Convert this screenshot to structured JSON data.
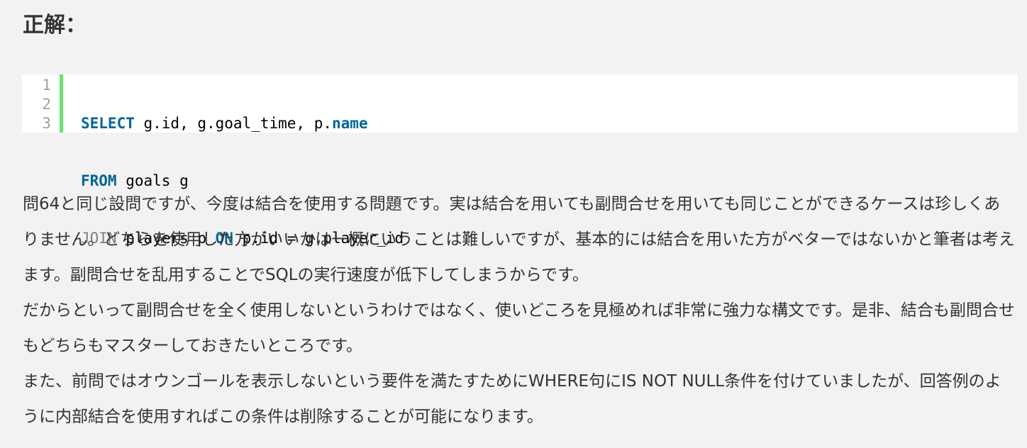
{
  "heading": "正解：",
  "code": {
    "line_numbers": [
      "1",
      "2",
      "3"
    ],
    "accent_color": "#6ce26c",
    "lines": [
      [
        {
          "text": "SELECT",
          "style": "keyword"
        },
        {
          "text": " g.id, g.goal_time, p.",
          "style": "plain"
        },
        {
          "text": "name",
          "style": "keyword"
        }
      ],
      [
        {
          "text": "FROM",
          "style": "keyword"
        },
        {
          "text": " goals g",
          "style": "plain"
        }
      ],
      [
        {
          "text": "JOIN",
          "style": "keyword-gray"
        },
        {
          "text": " players p ",
          "style": "plain"
        },
        {
          "text": "ON",
          "style": "keyword"
        },
        {
          "text": " p.id = g.player_id",
          "style": "plain"
        }
      ]
    ]
  },
  "explanation": {
    "paragraphs": [
      "問64と同じ設問ですが、今度は結合を使用する問題です。実は結合を用いても副問合せを用いても同じことができるケースは珍しくありません。どちらを使用した方がいいかは一概にいうことは難しいですが、基本的には結合を用いた方がベターではないかと筆者は考えます。副問合せを乱用することでSQLの実行速度が低下してしまうからです。",
      "だからといって副問合せを全く使用しないというわけではなく、使いどころを見極めれば非常に強力な構文です。是非、結合も副問合せもどちらもマスターしておきたいところです。",
      "また、前問ではオウンゴールを表示しないという要件を満たすためにWHERE句にIS NOT NULL条件を付けていましたが、回答例のように内部結合を使用すればこの条件は削除することが可能になります。"
    ]
  }
}
